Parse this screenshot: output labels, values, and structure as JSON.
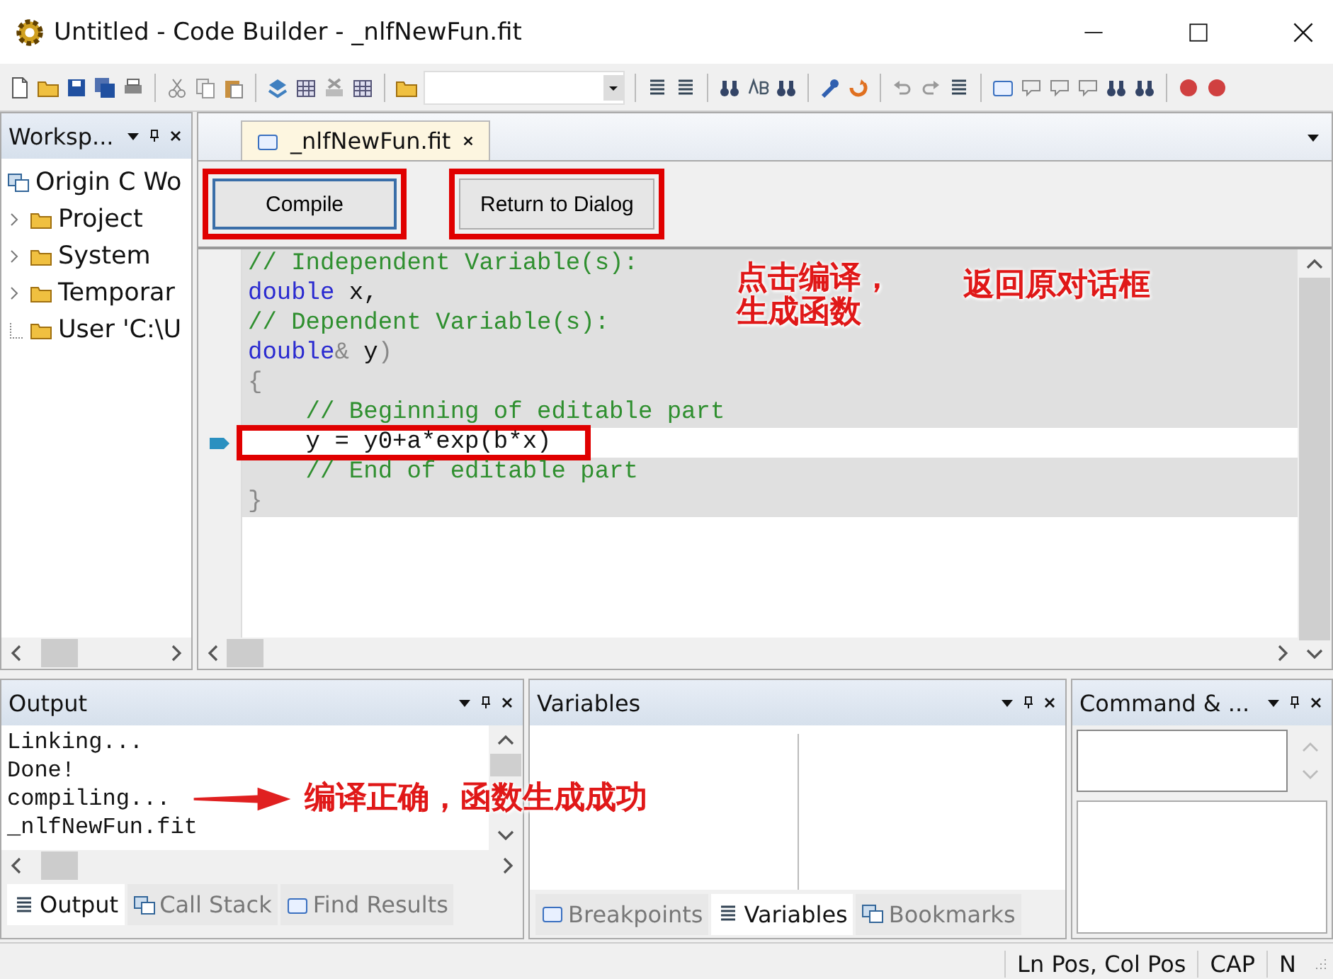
{
  "window": {
    "title": "Untitled - Code Builder - _nlfNewFun.fit"
  },
  "workspace": {
    "title": "Worksp...",
    "root": {
      "label": "Origin C Wo",
      "children": [
        {
          "label": "Project",
          "expandable": true
        },
        {
          "label": "System",
          "expandable": true
        },
        {
          "label": "Temporar",
          "expandable": true
        },
        {
          "label": "User 'C:\\U",
          "expandable": false
        }
      ]
    }
  },
  "editor": {
    "tabs": [
      {
        "label": "_nlfNewFun.fit",
        "selected": true
      }
    ],
    "buttons": [
      {
        "label": "Compile",
        "focused": true,
        "annotated": true
      },
      {
        "label": "Return to Dialog",
        "focused": false,
        "annotated": true
      }
    ],
    "lines": [
      {
        "current": false,
        "annotated": false,
        "tokens": [
          {
            "text": "// Independent Variable(s):",
            "kind": "comment"
          }
        ]
      },
      {
        "current": false,
        "annotated": false,
        "tokens": [
          {
            "text": "double",
            "kind": "keyword"
          },
          {
            "text": " x,",
            "kind": "plain"
          }
        ]
      },
      {
        "current": false,
        "annotated": false,
        "tokens": [
          {
            "text": "// Dependent Variable(s):",
            "kind": "comment"
          }
        ]
      },
      {
        "current": false,
        "annotated": false,
        "tokens": [
          {
            "text": "double",
            "kind": "keyword"
          },
          {
            "text": "&",
            "kind": "punct"
          },
          {
            "text": " y",
            "kind": "plain"
          },
          {
            "text": ")",
            "kind": "punct"
          }
        ]
      },
      {
        "current": false,
        "annotated": false,
        "tokens": [
          {
            "text": "{",
            "kind": "punct"
          }
        ]
      },
      {
        "current": false,
        "annotated": false,
        "tokens": [
          {
            "text": "    // Beginning of editable part",
            "kind": "comment"
          }
        ]
      },
      {
        "current": true,
        "annotated": true,
        "tokens": [
          {
            "text": "    y = y0+a*exp(b*x)",
            "kind": "plain"
          }
        ]
      },
      {
        "current": false,
        "annotated": false,
        "tokens": [
          {
            "text": "    // End of editable part",
            "kind": "comment"
          }
        ]
      },
      {
        "current": false,
        "annotated": false,
        "tokens": [
          {
            "text": "}",
            "kind": "punct"
          }
        ]
      }
    ]
  },
  "notes": [
    {
      "text": "点击编译，生成函数",
      "arrow": false
    },
    {
      "text": "返回原对话框",
      "arrow": false
    },
    {
      "text": "编译正确，函数生成成功",
      "arrow": true
    }
  ],
  "output": {
    "title": "Output",
    "lines": [
      "Linking...",
      "Done!",
      "compiling...",
      "_nlfNewFun.fit"
    ],
    "tabs": [
      {
        "label": "Output",
        "selected": true
      },
      {
        "label": "Call Stack",
        "selected": false
      },
      {
        "label": "Find Results",
        "selected": false
      }
    ]
  },
  "variables": {
    "title": "Variables",
    "tabs": [
      {
        "label": "Breakpoints",
        "selected": false
      },
      {
        "label": "Variables",
        "selected": true
      },
      {
        "label": "Bookmarks",
        "selected": false
      }
    ]
  },
  "command": {
    "title": "Command & ..."
  },
  "status_bar": [
    "Ln Pos, Col Pos",
    "CAP",
    "N"
  ]
}
